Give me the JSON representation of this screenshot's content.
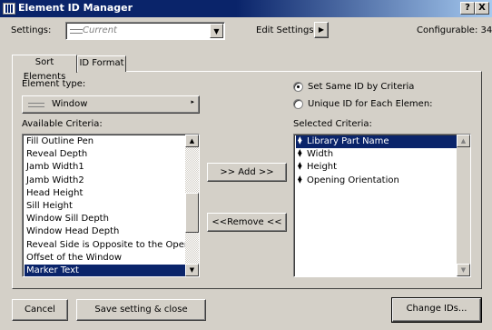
{
  "window": {
    "title": "Element ID Manager",
    "help": "?",
    "close": "X"
  },
  "settings": {
    "label": "Settings:",
    "value": "Current",
    "edit_label": "Edit Settings:",
    "configurable": "Configurable: 34"
  },
  "tabs": [
    "Sort Elements",
    "ID Format"
  ],
  "element_type": {
    "label": "Element type:",
    "value": "Window"
  },
  "available": {
    "label": "Available Criteria:",
    "items": [
      "Fill Outline Pen",
      "Reveal Depth",
      "Jamb Width1",
      "Jamb Width2",
      "Head Height",
      "Sill Height",
      "Window Sill Depth",
      "Window Head Depth",
      "Reveal Side is Opposite to the Openin...",
      "Offset of the Window",
      "Marker Text"
    ],
    "selected_index": 10
  },
  "buttons": {
    "add": ">> Add >>",
    "remove": "<<Remove <<",
    "cancel": "Cancel",
    "save_close": "Save setting & close",
    "change_ids": "Change IDs..."
  },
  "id_mode": {
    "same": "Set Same ID by Criteria",
    "unique": "Unique ID for Each Elemen:",
    "selected": "same"
  },
  "selected_criteria": {
    "label": "Selected Criteria:",
    "items": [
      "Library Part Name",
      "Width",
      "Height",
      "Opening Orientation"
    ],
    "selected_index": 0
  }
}
